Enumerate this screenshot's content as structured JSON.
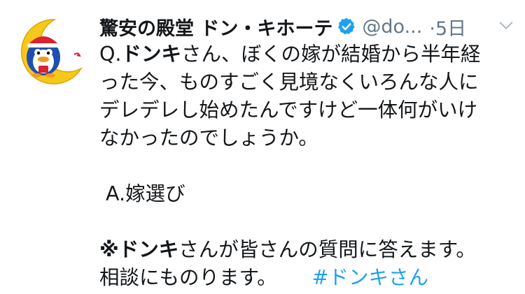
{
  "account": {
    "name": "驚安の殿堂 ドン・キホーテ",
    "handle": "@do...",
    "time_sep": "·",
    "time": "5日",
    "verified_icon": "verified-badge-icon",
    "colors": {
      "verified": "#1da1f2",
      "meta": "#657786",
      "hashtag": "#1da1f2"
    }
  },
  "tweet": {
    "q_prefix": "Q.",
    "q_name": "ドンキ",
    "q_line1_rest": "さん、ぼくの嫁が結婚から半年経",
    "q_line2": "った今、ものすごく見境なくいろんな人に",
    "q_line3": "デレデレし始めたんですけど一体何がいけ",
    "q_line4": "なかったのでしょうか。",
    "answer": " A.嫁選び",
    "note_mark": "※",
    "note_name": "ドンキ",
    "note_line1_rest": "さんが皆さんの質問に答えます。",
    "note_line2": "相談にものります。",
    "hashtag": "#ドンキさん"
  }
}
